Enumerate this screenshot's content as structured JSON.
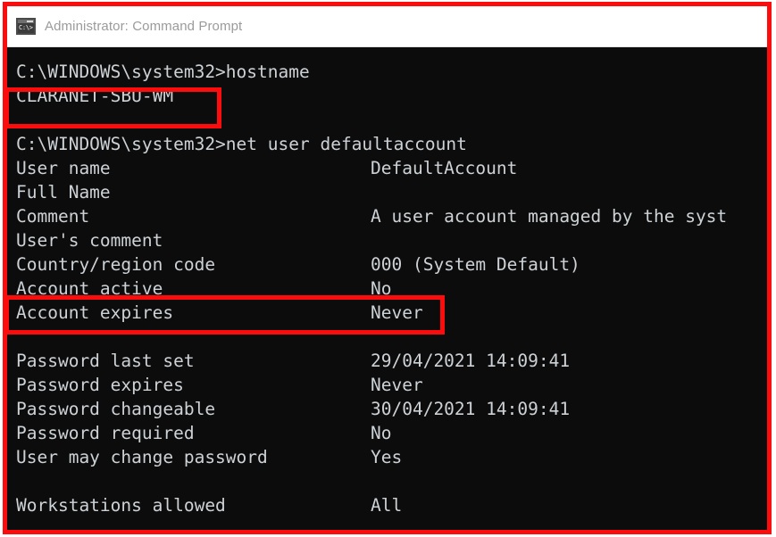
{
  "window": {
    "title": "Administrator: Command Prompt",
    "icon": "cmd-prompt-icon",
    "icon_glyph": "C:\\>",
    "titlebar_bg": "#ffffff",
    "title_color": "#9b9b9b",
    "console_bg": "#0c0c0c",
    "console_fg": "#cdd2d6"
  },
  "annotation": {
    "color": "#fb0d0d",
    "boxes": [
      {
        "name": "hostname-result",
        "target": "CLARANET-SBU-WM"
      },
      {
        "name": "account-active-row",
        "target": "Account active  No"
      }
    ]
  },
  "clipped_top_text": "▪▪ ▪ ▪      ▪ ▪▪▪  ▪▪ ▪ ▪      ▪ ▪ ▪    ▪      ▪      ▪ ▪     ▪    ▪     ▪ ▪ ▪    ▪",
  "console": {
    "lines": [
      {
        "text": "C:\\WINDOWS\\system32>hostname",
        "value": ""
      },
      {
        "text": "CLARANET-SBU-WM",
        "value": ""
      },
      {
        "text": "",
        "value": ""
      },
      {
        "text": "C:\\WINDOWS\\system32>net user defaultaccount",
        "value": ""
      },
      {
        "text": "User name",
        "value": "DefaultAccount"
      },
      {
        "text": "Full Name",
        "value": ""
      },
      {
        "text": "Comment",
        "value": "A user account managed by the syst"
      },
      {
        "text": "User's comment",
        "value": ""
      },
      {
        "text": "Country/region code",
        "value": "000 (System Default)"
      },
      {
        "text": "Account active",
        "value": "No"
      },
      {
        "text": "Account expires",
        "value": "Never"
      },
      {
        "text": "",
        "value": ""
      },
      {
        "text": "Password last set",
        "value": "29/04/2021 14:09:41"
      },
      {
        "text": "Password expires",
        "value": "Never"
      },
      {
        "text": "Password changeable",
        "value": "30/04/2021 14:09:41"
      },
      {
        "text": "Password required",
        "value": "No"
      },
      {
        "text": "User may change password",
        "value": "Yes"
      },
      {
        "text": "",
        "value": ""
      },
      {
        "text": "Workstations allowed",
        "value": "All"
      }
    ]
  }
}
